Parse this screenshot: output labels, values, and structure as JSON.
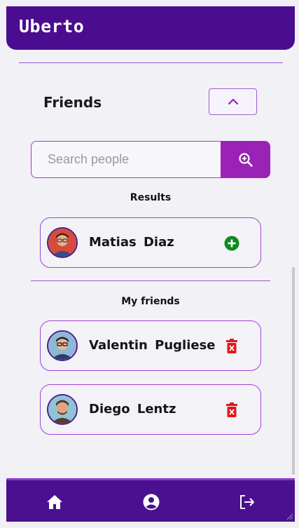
{
  "app": {
    "title": "Uberto"
  },
  "friends_section": {
    "title": "Friends"
  },
  "search": {
    "placeholder": "Search people",
    "value": ""
  },
  "results": {
    "label": "Results",
    "items": [
      {
        "first": "Matias",
        "last": "Diaz",
        "action": "add-icon"
      }
    ]
  },
  "my_friends": {
    "label": "My friends",
    "items": [
      {
        "first": "Valentin",
        "last": "Pugliese",
        "action": "trash-icon"
      },
      {
        "first": "Diego",
        "last": "Lentz",
        "action": "trash-icon"
      }
    ]
  },
  "nav": {
    "items": [
      "home-icon",
      "profile-icon",
      "logout-icon"
    ]
  },
  "colors": {
    "header": "#4b0d8f",
    "accent": "#9a22b6",
    "add": "#0f8a1e",
    "delete": "#e0191d"
  }
}
